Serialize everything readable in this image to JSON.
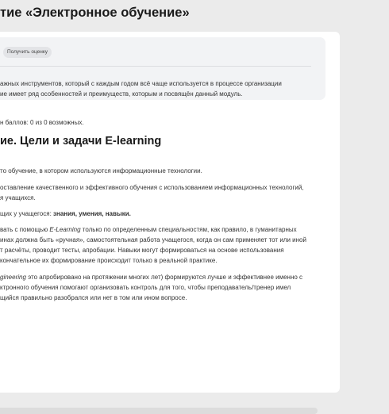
{
  "page": {
    "title": "тие «Электронное обучение»"
  },
  "info_box": {
    "button_label": "Получить оценку",
    "line1": "ажных инструментов, который с каждым годом всё чаще используется в процессе организации",
    "line2": "ие имеет ряд особенностей и преимуществ, которым и посвящён данный модуль."
  },
  "score_text": "н баллов: 0 из 0 возможных.",
  "section": {
    "title": "ие. Цели и задачи E-learning"
  },
  "content": {
    "p1": "то обучение, в котором используются информационные технологии.",
    "p2_line1": "оставление качественного и эффективного обучения с использованием информационных технологий,",
    "p2_line2": "я учащихся.",
    "p3_prefix": "щих у учащегося: ",
    "p3_bold": "знания, умения, навыки.",
    "p4_line1_pre": "вать с помощью ",
    "p4_line1_italic": "E-Learning",
    "p4_line1_post": " только по определенным специальностям, как правило, в гуманитарных",
    "p4_line2": "инах должна быть «ручная», самостоятельная работа учащегося, когда он сам применяет тот или иной",
    "p4_line3": "т расчёты, проводит тесты, апробации. Навыки могут формироваться на основе использования",
    "p4_line4": "кончательное их формирование происходит только в реальной практике.",
    "p5_line1_italic": "gineering",
    "p5_line1_post": " это апробировано на протяжении многих лет) формируются лучше и эффективнее именно с",
    "p5_line2": "ктронного обучения помогают организовать контроль для того, чтобы преподаватель/тренер имел",
    "p5_line3": "щийся правильно разобрался или нет в том или ином вопросе."
  }
}
